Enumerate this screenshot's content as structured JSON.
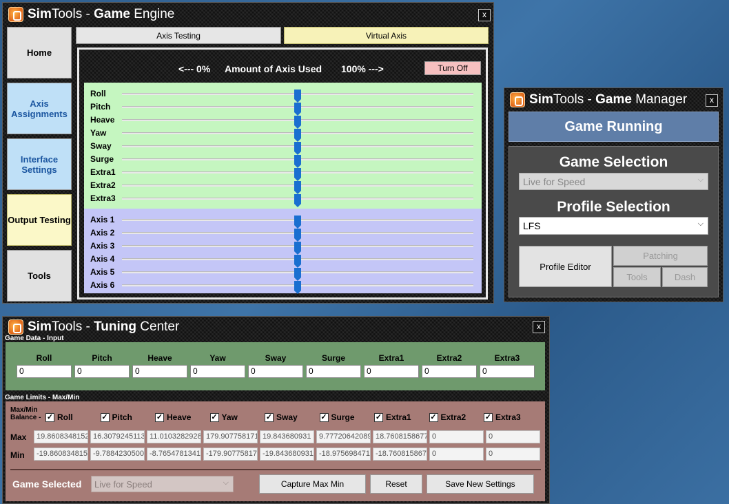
{
  "game_engine": {
    "title_prefix": "Sim",
    "title_mid": "Tools - ",
    "title_bold": "Game",
    "title_suffix": " Engine",
    "close": "x",
    "nav": [
      "Home",
      "Axis Assignments",
      "Interface Settings",
      "Output Testing",
      "Tools"
    ],
    "tabs": [
      "Axis Testing",
      "Virtual Axis"
    ],
    "axis_header": {
      "left": "<--- 0%",
      "center": "Amount of Axis Used",
      "right": "100% --->"
    },
    "turn_off": "Turn Off",
    "game_axes": [
      "Roll",
      "Pitch",
      "Heave",
      "Yaw",
      "Sway",
      "Surge",
      "Extra1",
      "Extra2",
      "Extra3"
    ],
    "output_axes": [
      "Axis 1",
      "Axis 2",
      "Axis 3",
      "Axis 4",
      "Axis 5",
      "Axis 6"
    ],
    "slider_level_percent": 50,
    "colors": {
      "green_panel": "#c5f6c0",
      "blue_panel": "#c4c6f7",
      "thumb": "#1a6fd0",
      "turn_off": "#f6c0c0"
    }
  },
  "game_manager": {
    "title_prefix": "Sim",
    "title_mid": "Tools - ",
    "title_bold": "Game",
    "title_suffix": " Manager",
    "close": "x",
    "status": "Game Running",
    "game_selection_label": "Game Selection",
    "game_selection_value": "Live for Speed",
    "profile_selection_label": "Profile Selection",
    "profile_selection_value": "LFS",
    "profile_editor": "Profile Editor",
    "patching": "Patching",
    "tools": "Tools",
    "dash": "Dash"
  },
  "tuning_center": {
    "title_prefix": "Sim",
    "title_mid": "Tools - ",
    "title_bold": "Tuning",
    "title_suffix": " Center",
    "close": "x",
    "game_data_label": "Game Data - Input",
    "columns": [
      "Roll",
      "Pitch",
      "Heave",
      "Yaw",
      "Sway",
      "Surge",
      "Extra1",
      "Extra2",
      "Extra3"
    ],
    "inputs": [
      "0",
      "0",
      "0",
      "0",
      "0",
      "0",
      "0",
      "0",
      "0"
    ],
    "limits_label": "Game Limits - Max/Min",
    "balance_label_1": "Max/Min",
    "balance_label_2": "Balance -",
    "balance_checks": [
      "Roll",
      "Pitch",
      "Heave",
      "Yaw",
      "Sway",
      "Surge",
      "Extra1",
      "Extra2",
      "Extra3"
    ],
    "check_mark": "✓",
    "max_label": "Max",
    "min_label": "Min",
    "max_values": [
      "19.8608348152",
      "16.3079245113",
      "11.0103282928",
      "179.907758171",
      "19.843680931",
      "9.77720642089",
      "18.7608158677",
      "0",
      "0"
    ],
    "min_values": [
      "-19.860834815",
      "-9.7884230500",
      "-8.7654781341",
      "-179.90775817",
      "-19.843680931",
      "-18.975698471",
      "-18.760815867",
      "0",
      "0"
    ],
    "game_selected_label": "Game Selected",
    "game_selected_value": "Live for Speed",
    "capture": "Capture Max Min",
    "reset": "Reset",
    "save": "Save New Settings",
    "colors": {
      "input_panel": "#6f9a6d",
      "limits_panel": "#a67b76"
    }
  }
}
